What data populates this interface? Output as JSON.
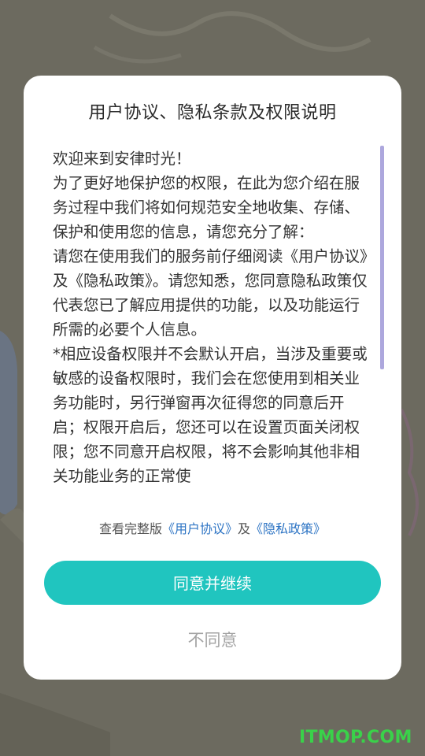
{
  "dialog": {
    "title": "用户协议、隐私条款及权限说明",
    "paragraphs": [
      "欢迎来到安律时光！",
      "为了更好地保护您的权限，在此为您介绍在服务过程中我们将如何规范安全地收集、存储、保护和使用您的信息，请您充分了解：",
      "请您在使用我们的服务前仔细阅读《用户协议》及《隐私政策》。请您知悉，您同意隐私政策仅代表您已了解应用提供的功能，以及功能运行所需的必要个人信息。",
      "*相应设备权限并不会默认开启，当涉及重要或敏感的设备权限时，我们会在您使用到相关业务功能时，另行弹窗再次征得您的同意后开启；权限开启后，您还可以在设置页面关闭权限；您不同意开启权限，将不会影响其他非相关功能业务的正常使"
    ],
    "links_prefix": "查看完整版",
    "user_agreement_link": "《用户协议》",
    "links_conjunction": "及",
    "privacy_policy_link": "《隐私政策》",
    "agree_label": "同意并继续",
    "disagree_label": "不同意"
  },
  "colors": {
    "accent": "#20c5bf",
    "link": "#2d74c4",
    "scrollbar": "#ada7dd",
    "overlay": "#6c6a5f"
  },
  "watermark": {
    "text": "ITMOP.COM"
  }
}
